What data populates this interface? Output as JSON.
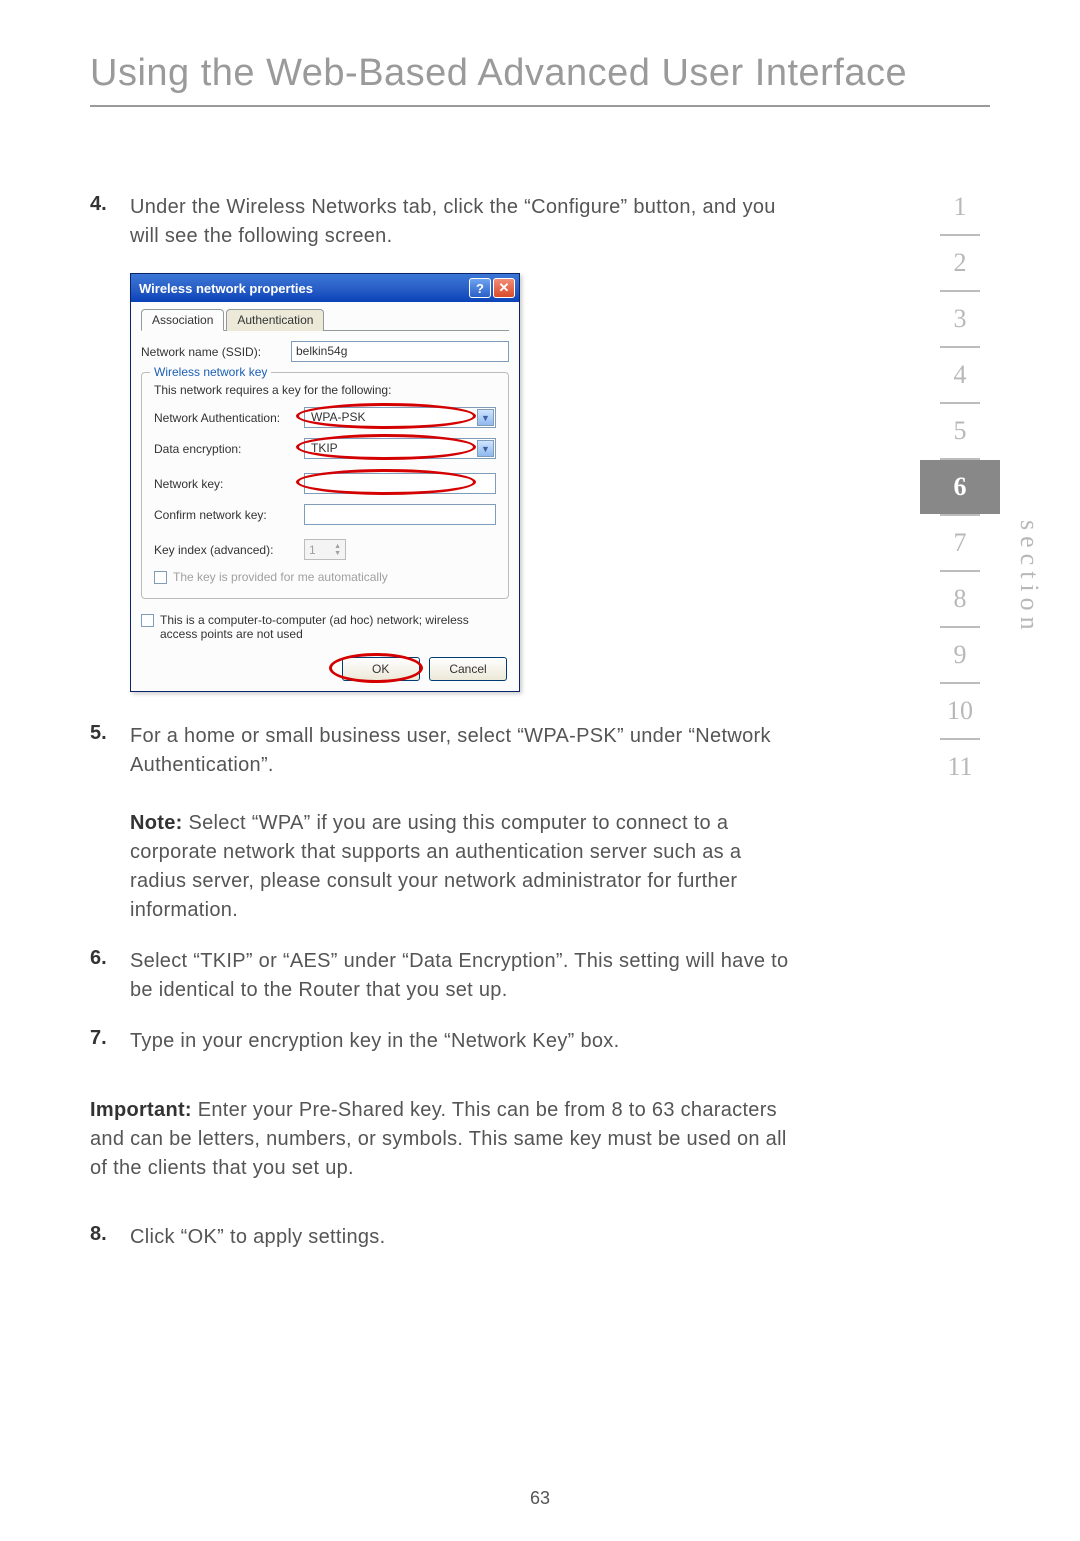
{
  "page_title": "Using the Web-Based Advanced User Interface",
  "page_number": "63",
  "section_label": "section",
  "nav": {
    "items": [
      "1",
      "2",
      "3",
      "4",
      "5",
      "6",
      "7",
      "8",
      "9",
      "10",
      "11"
    ],
    "active_index": 5
  },
  "steps": {
    "s4": {
      "num": "4.",
      "text": "Under the Wireless Networks tab, click the “Configure” button, and you will see the following screen."
    },
    "s5": {
      "num": "5.",
      "text": "For a home or small business user, select “WPA-PSK” under “Network Authentication”.",
      "note_label": "Note:",
      "note_text": " Select “WPA” if you are using this computer to connect to a corporate network that supports an authentication server such as a radius server, please consult your network administrator for further information."
    },
    "s6": {
      "num": "6.",
      "text": "Select “TKIP” or “AES” under “Data Encryption”. This setting will have to be identical to the Router that you set up."
    },
    "s7": {
      "num": "7.",
      "text": "Type in your encryption key in the “Network Key” box."
    },
    "s8": {
      "num": "8.",
      "text": "Click “OK” to apply settings."
    }
  },
  "important": {
    "label": "Important:",
    "text": " Enter your Pre-Shared key. This can be from 8 to 63 characters and can be letters, numbers, or symbols. This same key must be used on all of the clients that you set up."
  },
  "dialog": {
    "title": "Wireless network properties",
    "help_glyph": "?",
    "close_glyph": "✕",
    "tabs": {
      "association": "Association",
      "authentication": "Authentication"
    },
    "ssid_label": "Network name (SSID):",
    "ssid_value": "belkin54g",
    "group_legend": "Wireless network key",
    "key_note": "This network requires a key for the following:",
    "auth_label": "Network Authentication:",
    "auth_value": "WPA-PSK",
    "enc_label": "Data encryption:",
    "enc_value": "TKIP",
    "netkey_label": "Network key:",
    "netkey_value": "",
    "confirm_label": "Confirm network key:",
    "confirm_value": "",
    "keyindex_label": "Key index (advanced):",
    "keyindex_value": "1",
    "auto_key_label": "The key is provided for me automatically",
    "adhoc_label": "This is a computer-to-computer (ad hoc) network; wireless access points are not used",
    "ok": "OK",
    "cancel": "Cancel",
    "dd_arrow": "▼",
    "spin_up": "▲",
    "spin_down": "▼"
  }
}
